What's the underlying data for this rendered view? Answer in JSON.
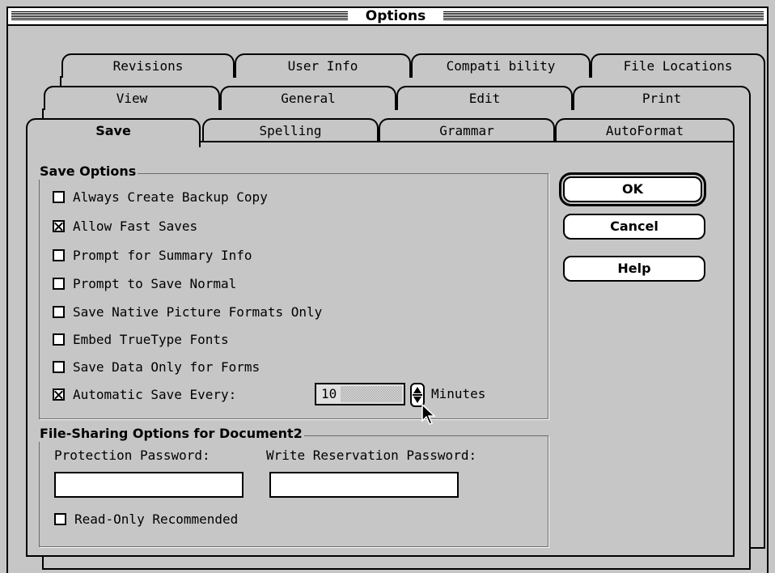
{
  "window": {
    "title": "Options"
  },
  "tabs": {
    "row1": [
      "Revisions",
      "User Info",
      "Compati bility",
      "File Locations"
    ],
    "row2": [
      "View",
      "General",
      "Edit",
      "Print"
    ],
    "row3": [
      "Save",
      "Spelling",
      "Grammar",
      "AutoFormat"
    ],
    "active": "Save"
  },
  "save_options": {
    "title": "Save Options",
    "items": [
      {
        "label": "Always Create Backup Copy",
        "checked": false
      },
      {
        "label": "Allow Fast Saves",
        "checked": true
      },
      {
        "label": "Prompt for Summary Info",
        "checked": false
      },
      {
        "label": "Prompt to Save Normal",
        "checked": false
      },
      {
        "label": "Save Native Picture Formats Only",
        "checked": false
      },
      {
        "label": "Embed TrueType Fonts",
        "checked": false
      },
      {
        "label": "Save Data Only for Forms",
        "checked": false
      },
      {
        "label": "Automatic Save Every:",
        "checked": true
      }
    ],
    "autosave_value": "10",
    "autosave_unit": "Minutes"
  },
  "file_sharing": {
    "title": "File-Sharing Options for Document2",
    "protection_label": "Protection Password:",
    "protection_value": "",
    "write_label": "Write Reservation Password:",
    "write_value": "",
    "readonly_label": "Read-Only Recommended",
    "readonly_checked": false
  },
  "buttons": {
    "ok": "OK",
    "cancel": "Cancel",
    "help": "Help"
  },
  "icons": {
    "cursor": "arrow-cursor-icon",
    "spinner": "up-down-arrows-icon"
  }
}
